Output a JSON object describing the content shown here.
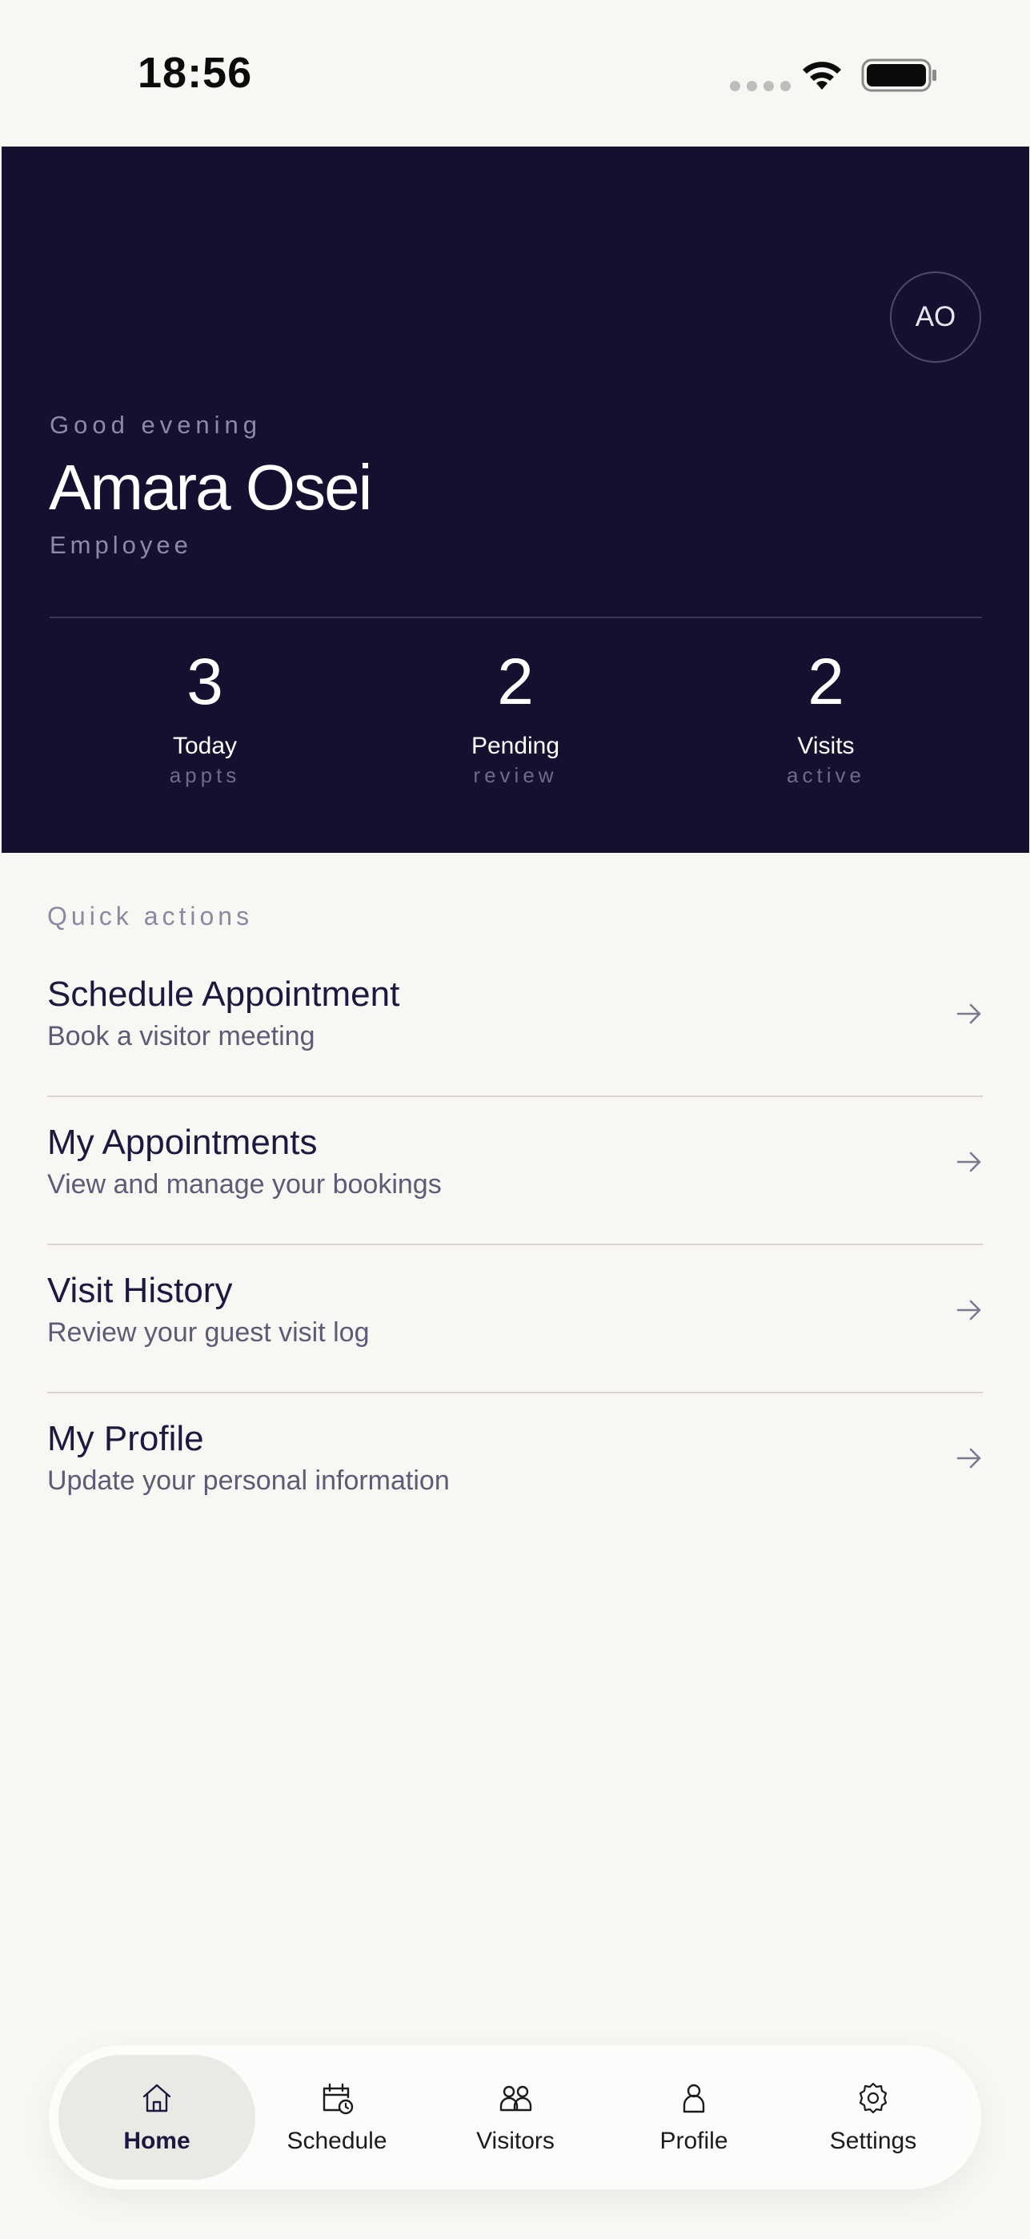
{
  "status_bar": {
    "time": "18:56"
  },
  "hero": {
    "avatar_initials": "AO",
    "greeting": "Good evening",
    "name": "Amara Osei",
    "role": "Employee",
    "stats": [
      {
        "value": "3",
        "label": "Today",
        "sub": "appts"
      },
      {
        "value": "2",
        "label": "Pending",
        "sub": "review"
      },
      {
        "value": "2",
        "label": "Visits",
        "sub": "active"
      }
    ]
  },
  "quick_actions": {
    "title": "Quick actions",
    "items": [
      {
        "title": "Schedule Appointment",
        "description": "Book a visitor meeting"
      },
      {
        "title": "My Appointments",
        "description": "View and manage your bookings"
      },
      {
        "title": "Visit History",
        "description": "Review your guest visit log"
      },
      {
        "title": "My Profile",
        "description": "Update your personal information"
      }
    ]
  },
  "bottom_nav": {
    "items": [
      {
        "label": "Home",
        "icon": "home-icon",
        "active": true
      },
      {
        "label": "Schedule",
        "icon": "calendar-clock-icon",
        "active": false
      },
      {
        "label": "Visitors",
        "icon": "people-icon",
        "active": false
      },
      {
        "label": "Profile",
        "icon": "person-icon",
        "active": false
      },
      {
        "label": "Settings",
        "icon": "gear-icon",
        "active": false
      }
    ]
  },
  "colors": {
    "hero_background": "#161030",
    "page_background": "#f9f7f3",
    "text_primary": "#1c1840",
    "text_secondary": "#5f5a76",
    "active_tab_background": "#ebe9e4"
  }
}
